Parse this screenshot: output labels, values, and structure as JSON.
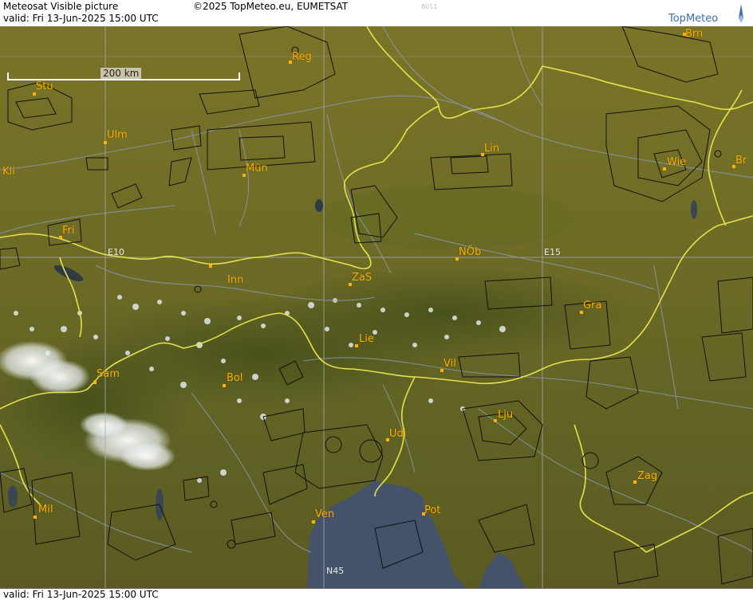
{
  "header": {
    "title": "Meteosat Visible picture",
    "copyright": "©2025 TopMeteo.eu, EUMETSAT",
    "valid_time": "valid:  Fri  13-Jun-2025  15:00 UTC",
    "code": "8011",
    "brand": "TopMeteo"
  },
  "footer": {
    "valid_time": "valid:  Fri  13-Jun-2025  15:00 UTC"
  },
  "scale_bar": {
    "label": "200 km"
  },
  "grid_labels": {
    "lon_e10": "E10",
    "lon_e15": "E15",
    "lat_n45": "N45"
  },
  "cities": [
    {
      "id": "brn",
      "label": "Brn"
    },
    {
      "id": "reg",
      "label": "Reg"
    },
    {
      "id": "stu",
      "label": "Stu"
    },
    {
      "id": "ulm",
      "label": "Ulm"
    },
    {
      "id": "mun",
      "label": "Mün"
    },
    {
      "id": "kli",
      "label": "Kli"
    },
    {
      "id": "lin",
      "label": "Lin"
    },
    {
      "id": "wie",
      "label": "Wie"
    },
    {
      "id": "bra",
      "label": "Br"
    },
    {
      "id": "fri",
      "label": "Fri"
    },
    {
      "id": "nob",
      "label": "NÖb"
    },
    {
      "id": "inn",
      "label": "Inn"
    },
    {
      "id": "zas",
      "label": "ZaS"
    },
    {
      "id": "gra",
      "label": "Gra"
    },
    {
      "id": "lie",
      "label": "Lie"
    },
    {
      "id": "vil",
      "label": "Vil"
    },
    {
      "id": "sam",
      "label": "Sam"
    },
    {
      "id": "bol",
      "label": "Bol"
    },
    {
      "id": "lju",
      "label": "Lju"
    },
    {
      "id": "udi",
      "label": "Udi"
    },
    {
      "id": "zag",
      "label": "Zag"
    },
    {
      "id": "mil",
      "label": "Mil"
    },
    {
      "id": "ven",
      "label": "Ven"
    },
    {
      "id": "pot",
      "label": "Pot"
    }
  ]
}
